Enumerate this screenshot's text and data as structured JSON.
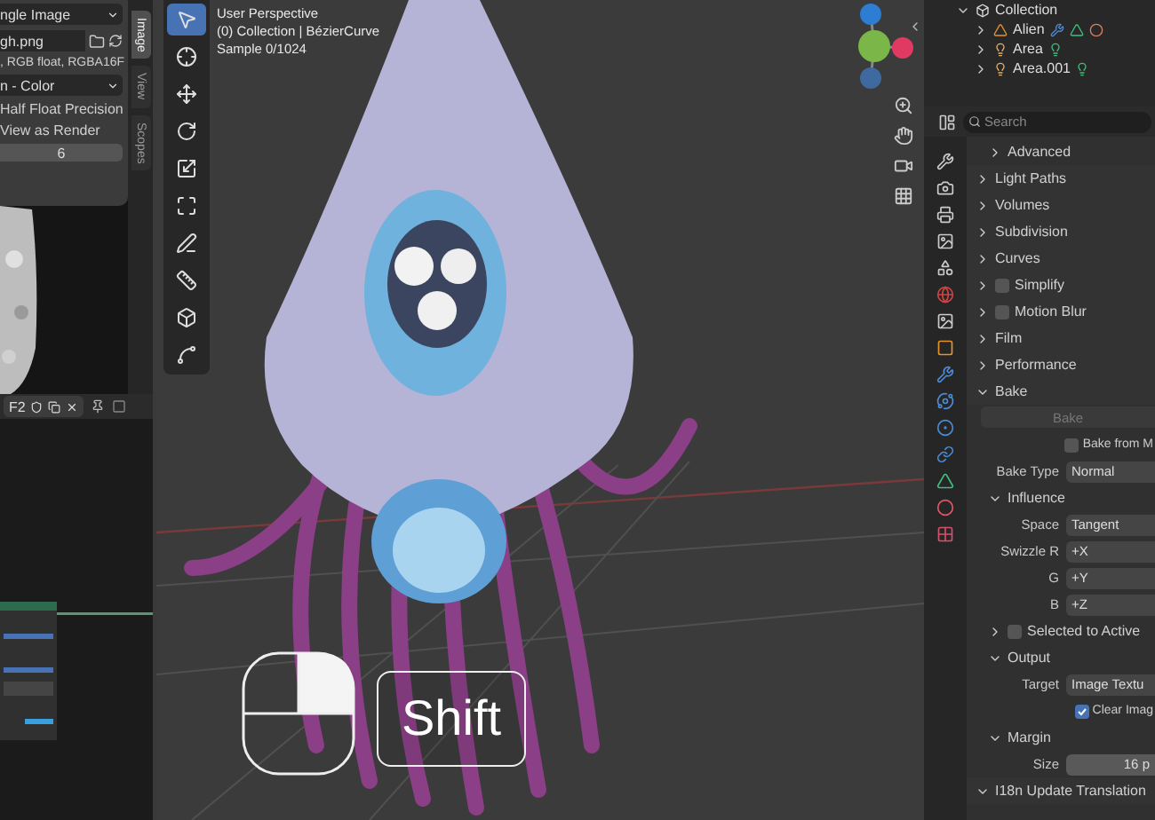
{
  "image_editor": {
    "sidebar": {
      "image_menu": "ngle Image",
      "file_path": "gh.png",
      "info": ", RGB float, RGBA16F",
      "color_space": "n - Color",
      "options": [
        "Half Float Precision",
        "View as Render"
      ],
      "value": "6"
    },
    "tabs": [
      {
        "label": "Image",
        "selected": true
      },
      {
        "label": "View",
        "selected": false
      },
      {
        "label": "Scopes",
        "selected": false
      }
    ],
    "header": {
      "slot": "F2"
    }
  },
  "viewport": {
    "overlay_lines": [
      "User Perspective",
      "(0) Collection | BézierCurve",
      "Sample 0/1024"
    ],
    "tools": [
      {
        "kind": "select",
        "selected": true
      },
      {
        "kind": "cursor",
        "selected": false
      },
      {
        "kind": "move",
        "selected": false
      },
      {
        "kind": "rotate",
        "selected": false
      },
      {
        "kind": "scale",
        "selected": false
      },
      {
        "kind": "transform",
        "selected": false
      },
      {
        "kind": "annotate",
        "selected": false
      },
      {
        "kind": "measure",
        "selected": false
      },
      {
        "kind": "add_cube",
        "selected": false
      },
      {
        "kind": "curve",
        "selected": false
      }
    ],
    "key": "Shift"
  },
  "outliner": {
    "items": [
      {
        "name": "Collection",
        "kind": "collection",
        "expanded": true,
        "children": [
          {
            "name": "Alien",
            "kind": "mesh",
            "expanded": false
          },
          {
            "name": "Area",
            "kind": "light",
            "expanded": false
          },
          {
            "name": "Area.001",
            "kind": "light",
            "expanded": false
          }
        ]
      }
    ]
  },
  "properties": {
    "search": {
      "placeholder": "Search"
    },
    "rows": [
      {
        "kind": "subpanel",
        "label": "Advanced",
        "expanded": false
      },
      {
        "kind": "panel",
        "label": "Light Paths",
        "expanded": false
      },
      {
        "kind": "panel",
        "label": "Volumes",
        "expanded": false
      },
      {
        "kind": "panel",
        "label": "Subdivision",
        "expanded": false
      },
      {
        "kind": "panel",
        "label": "Curves",
        "expanded": false
      },
      {
        "kind": "panel",
        "label": "Simplify",
        "expanded": false,
        "checked": false
      },
      {
        "kind": "panel",
        "label": "Motion Blur",
        "expanded": false,
        "checked": false
      },
      {
        "kind": "panel",
        "label": "Film",
        "expanded": false
      },
      {
        "kind": "panel",
        "label": "Performance",
        "expanded": false
      },
      {
        "kind": "panel",
        "label": "Bake",
        "expanded": true
      },
      {
        "kind": "button",
        "label": "Bake",
        "disabled": true
      },
      {
        "kind": "checkbox",
        "label": "Bake from M",
        "checked": false
      },
      {
        "kind": "field",
        "label": "Bake Type",
        "value": "Normal"
      },
      {
        "kind": "subpanel",
        "label": "Influence",
        "expanded": true
      },
      {
        "kind": "field",
        "label": "Space",
        "value": "Tangent"
      },
      {
        "kind": "field",
        "label": "Swizzle R",
        "value": "+X"
      },
      {
        "kind": "field",
        "label": "G",
        "value": "+Y"
      },
      {
        "kind": "field",
        "label": "B",
        "value": "+Z"
      },
      {
        "kind": "subpanel",
        "label": "Selected to Active",
        "expanded": false,
        "checked": false
      },
      {
        "kind": "subpanel",
        "label": "Output",
        "expanded": true
      },
      {
        "kind": "field",
        "label": "Target",
        "value": "Image Textu"
      },
      {
        "kind": "checkbox",
        "label": "Clear Imag",
        "checked": true
      },
      {
        "kind": "subpanel",
        "label": "Margin",
        "expanded": true
      },
      {
        "kind": "number",
        "label": "Size",
        "value": "16 p"
      },
      {
        "kind": "panel",
        "label": "I18n Update Translation",
        "expanded": true
      }
    ]
  }
}
